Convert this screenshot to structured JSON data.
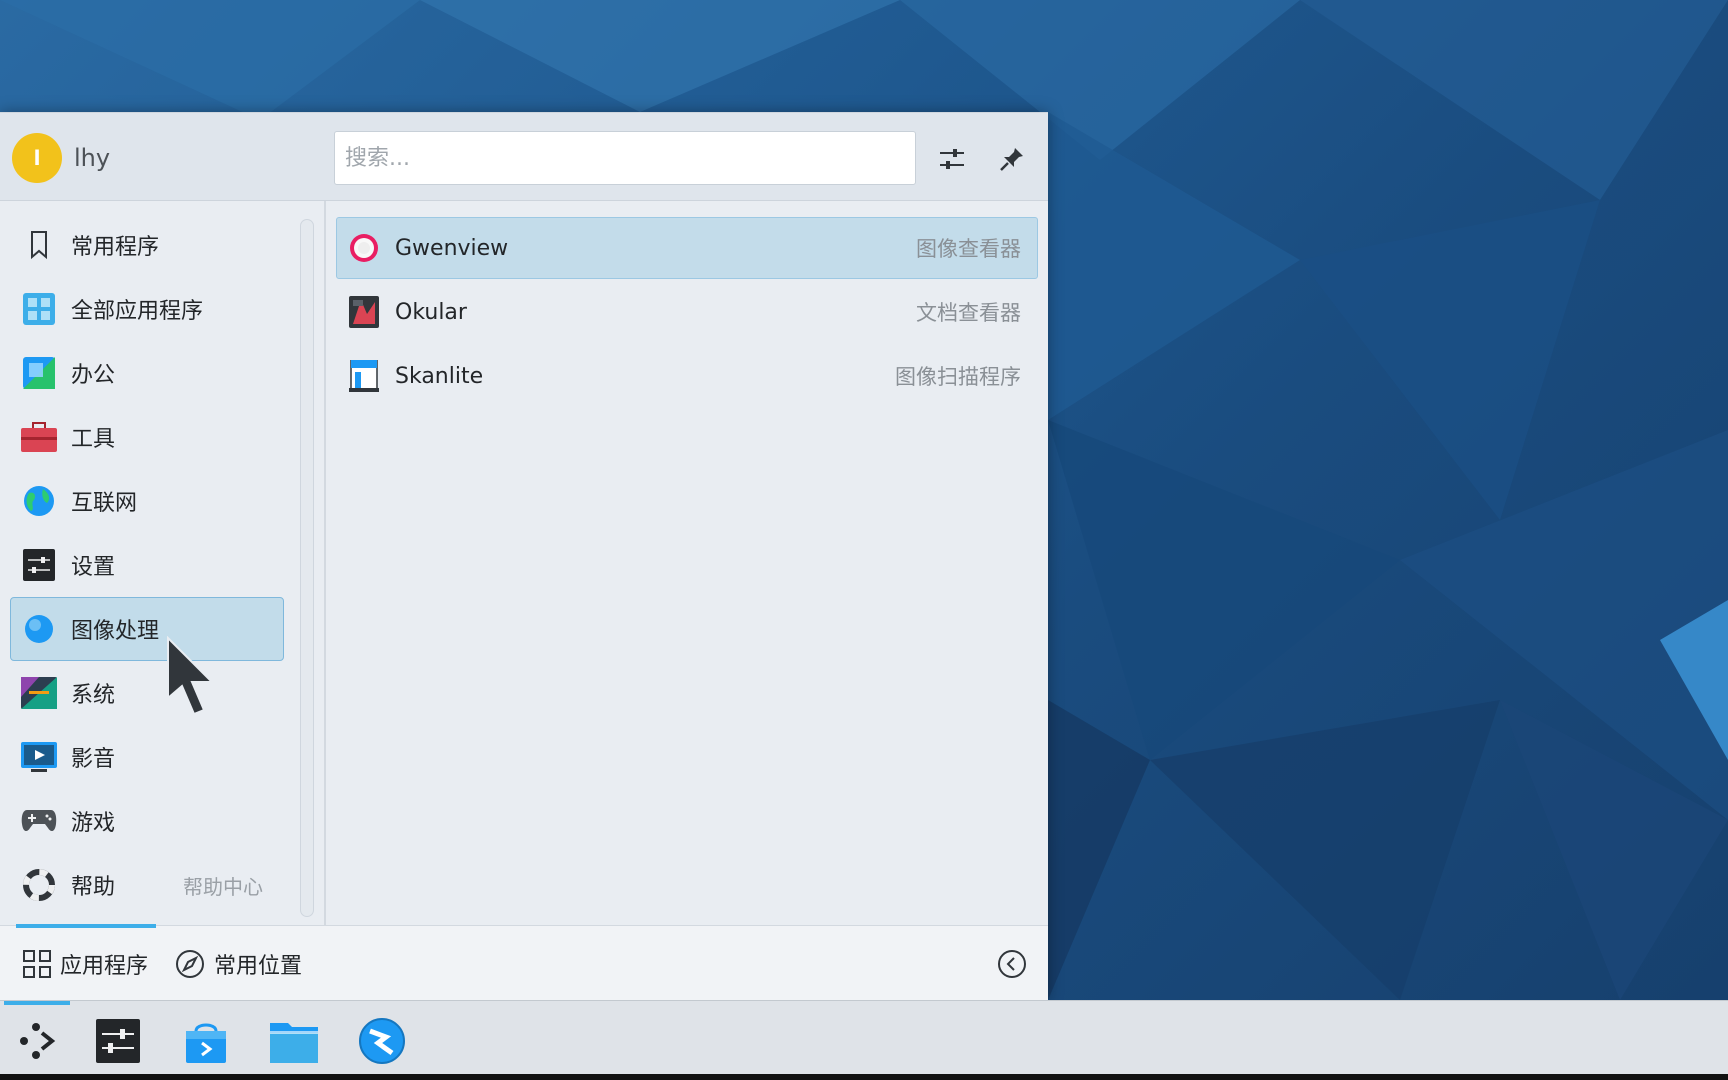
{
  "user": {
    "initial": "l",
    "name": "lhy"
  },
  "search": {
    "placeholder": "搜索..."
  },
  "header_buttons": [
    {
      "icon": "configure-icon"
    },
    {
      "icon": "pin-icon"
    }
  ],
  "categories": [
    {
      "label": "常用程序",
      "icon": "bookmark-icon",
      "selected": false
    },
    {
      "label": "全部应用程序",
      "icon": "grid-apps-icon",
      "selected": false
    },
    {
      "label": "办公",
      "icon": "office-icon",
      "selected": false
    },
    {
      "label": "工具",
      "icon": "toolbox-icon",
      "selected": false
    },
    {
      "label": "互联网",
      "icon": "globe-icon",
      "selected": false
    },
    {
      "label": "设置",
      "icon": "settings-icon",
      "selected": false
    },
    {
      "label": "图像处理",
      "icon": "graphics-icon",
      "selected": true
    },
    {
      "label": "系统",
      "icon": "system-icon",
      "selected": false
    },
    {
      "label": "影音",
      "icon": "multimedia-icon",
      "selected": false
    },
    {
      "label": "游戏",
      "icon": "gamepad-icon",
      "selected": false
    },
    {
      "label": "帮助",
      "icon": "help-lifebuoy-icon",
      "sub": "帮助中心",
      "selected": false
    }
  ],
  "apps": [
    {
      "name": "Gwenview",
      "desc": "图像查看器",
      "icon": "gwenview-icon",
      "selected": true
    },
    {
      "name": "Okular",
      "desc": "文档查看器",
      "icon": "okular-icon",
      "selected": false
    },
    {
      "name": "Skanlite",
      "desc": "图像扫描程序",
      "icon": "skanlite-icon",
      "selected": false
    }
  ],
  "footer": {
    "tabs": [
      {
        "label": "应用程序",
        "icon": "applications-grid-icon",
        "active": true
      },
      {
        "label": "常用位置",
        "icon": "compass-icon",
        "active": false
      }
    ]
  },
  "taskbar": {
    "items": [
      {
        "icon": "app-launcher-icon",
        "active": true
      },
      {
        "icon": "system-settings-icon",
        "active": false
      },
      {
        "icon": "discover-store-icon",
        "active": false
      },
      {
        "icon": "dolphin-folder-icon",
        "active": false
      },
      {
        "icon": "web-browser-icon",
        "active": false
      }
    ]
  },
  "colors": {
    "accent": "#3daee9",
    "selection_bg": "#c2dcea",
    "panel_bg": "#e9edf2",
    "wallpaper": "#1f5990"
  }
}
